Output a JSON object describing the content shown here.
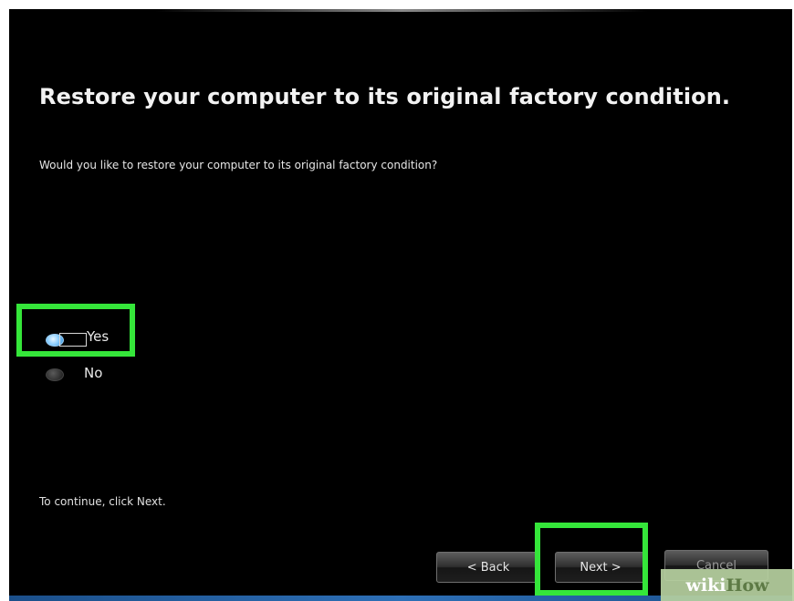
{
  "dialog": {
    "title": "Restore your computer to its original factory condition.",
    "question": "Would you like to restore your computer to its original factory condition?",
    "options": [
      {
        "label": "Yes",
        "selected": true
      },
      {
        "label": "No",
        "selected": false
      }
    ],
    "instruction": "To continue, click Next."
  },
  "buttons": {
    "back": "< Back",
    "next": "Next >",
    "cancel": "Cancel"
  },
  "watermark": {
    "part1": "wiki",
    "part2": "How"
  },
  "colors": {
    "highlight": "#35e63a",
    "background": "#000000"
  }
}
